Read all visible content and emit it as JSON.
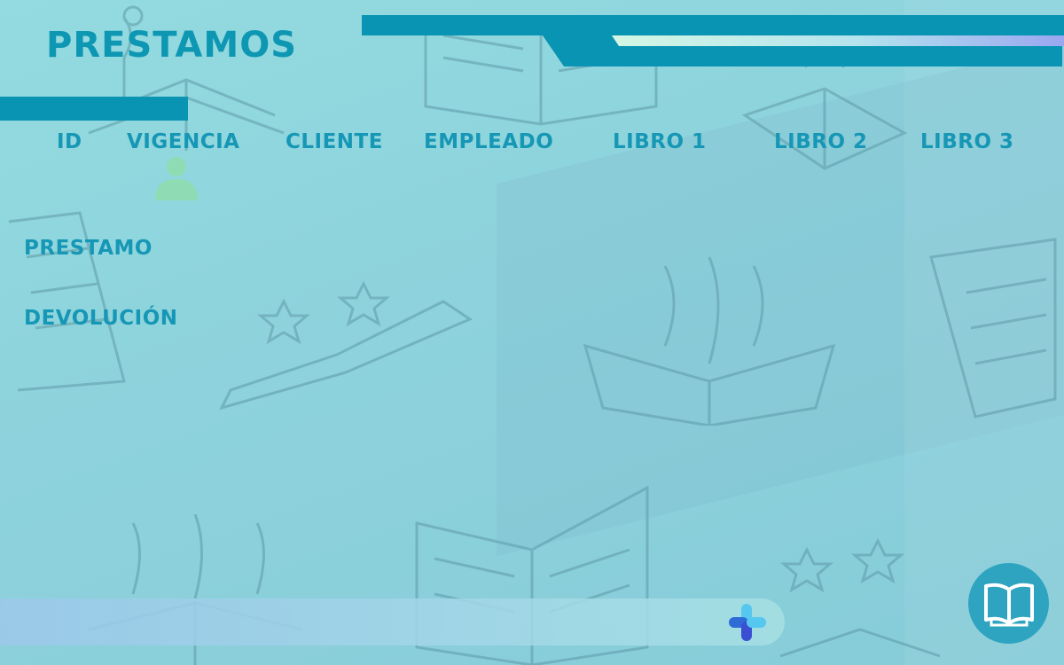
{
  "page": {
    "title": "PRESTAMOS"
  },
  "columns": [
    {
      "label": "ID"
    },
    {
      "label": "VIGENCIA"
    },
    {
      "label": "CLIENTE"
    },
    {
      "label": "EMPLEADO"
    },
    {
      "label": "LIBRO 1"
    },
    {
      "label": "LIBRO 2"
    },
    {
      "label": "LIBRO 3"
    }
  ],
  "menu": {
    "prestamo_label": "PRESTAMO",
    "devolucion_label": "DEVOLUCIÓN"
  },
  "icons": {
    "user": "user-icon",
    "add": "plus-icon",
    "book": "open-book-icon"
  },
  "colors": {
    "accent": "#0a94b3",
    "text": "#1697b5",
    "background": "#8fd6dc",
    "user_icon": "#8fdcb4",
    "add_icon_blue": "#2f6bd6",
    "add_icon_light": "#56c8f0"
  }
}
